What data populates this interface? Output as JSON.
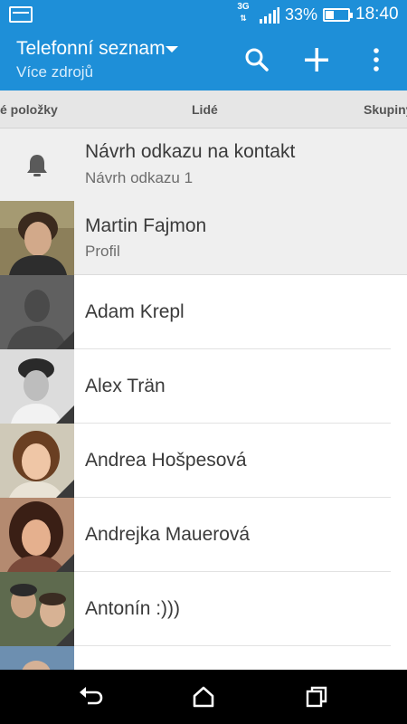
{
  "status_bar": {
    "network": "3G",
    "battery_percent_text": "33%",
    "battery_level": 0.33,
    "time": "18:40",
    "icons": [
      "notification-icon",
      "signal-icon",
      "battery-icon"
    ]
  },
  "app_bar": {
    "title": "Telefonní seznam",
    "subtitle": "Více zdrojů",
    "actions": [
      "search-icon",
      "add-icon",
      "overflow-menu-icon"
    ]
  },
  "tabs": {
    "left": "é položky",
    "center": "Lidé",
    "right": "Skupiny"
  },
  "suggestion": {
    "icon": "bell-icon",
    "title": "Návrh odkazu na kontakt",
    "subtitle": "Návrh odkazu 1"
  },
  "profile": {
    "name": "Martin Fajmon",
    "subtitle": "Profil"
  },
  "contacts": [
    {
      "name": "Adam Krepl"
    },
    {
      "name": "Alex Trän"
    },
    {
      "name": "Andrea Hošpesová"
    },
    {
      "name": "Andrejka Mauerová"
    },
    {
      "name": "Antonín :)))"
    },
    {
      "name": ""
    }
  ],
  "colors": {
    "accent": "#1e8fd8",
    "tab_bar": "#e6e6e6",
    "highlight_row": "#efefef",
    "text": "#3a3a3a"
  },
  "nav_bar": {
    "icons": [
      "back-icon",
      "home-icon",
      "recent-apps-icon"
    ]
  }
}
